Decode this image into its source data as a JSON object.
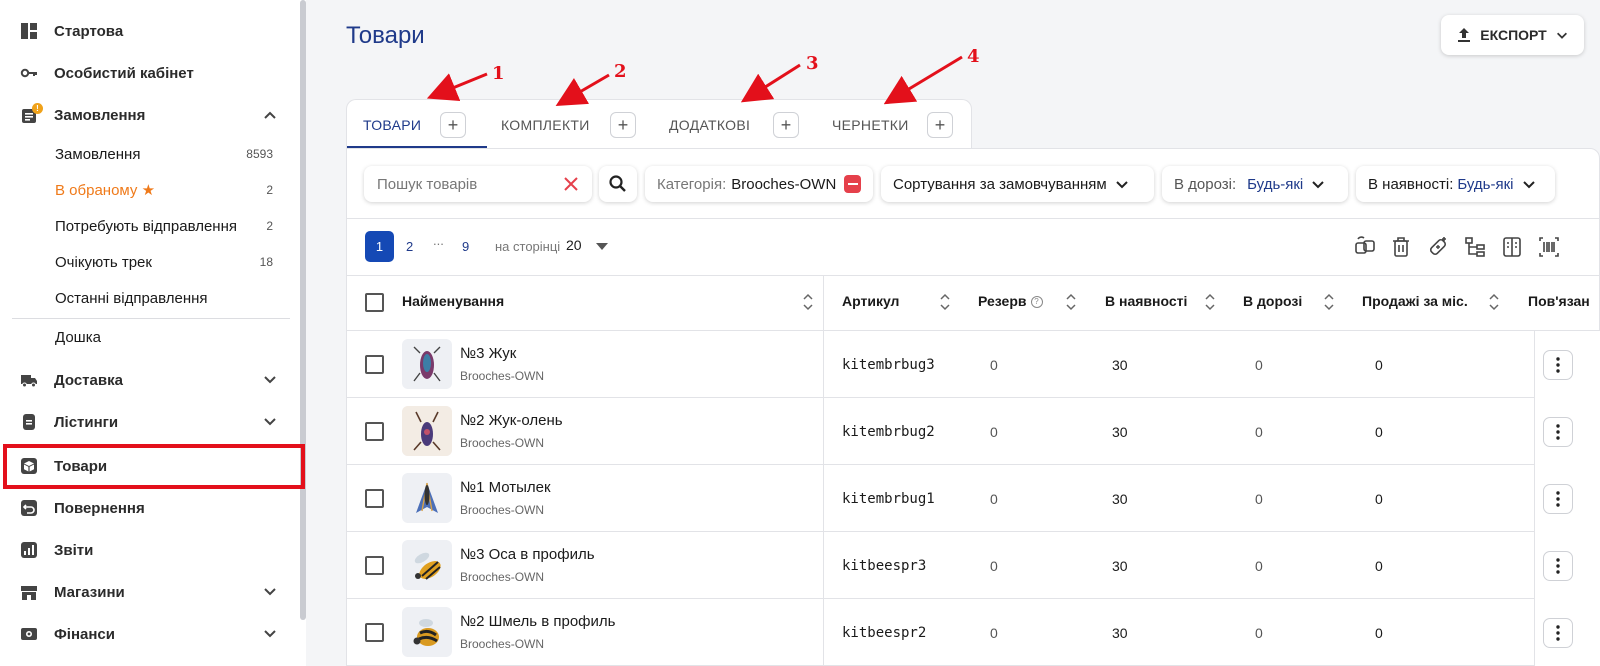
{
  "sidebar": {
    "items": [
      {
        "label": "Стартова"
      },
      {
        "label": "Особистий кабінет"
      },
      {
        "label": "Замовлення",
        "badge": "!"
      },
      {
        "label": "Дошка"
      },
      {
        "label": "Доставка"
      },
      {
        "label": "Лістинги"
      },
      {
        "label": "Товари"
      },
      {
        "label": "Повернення"
      },
      {
        "label": "Звіти"
      },
      {
        "label": "Магазини"
      },
      {
        "label": "Фінанси"
      }
    ],
    "orders_sub": [
      {
        "label": "Замовлення",
        "count": "8593"
      },
      {
        "label": "В обраному ★",
        "count": "2"
      },
      {
        "label": "Потребують відправлення",
        "count": "2"
      },
      {
        "label": "Очікують трек",
        "count": "18"
      },
      {
        "label": "Останні відправлення",
        "count": ""
      }
    ]
  },
  "header": {
    "title": "Товари",
    "export_label": "ЕКСПОРТ"
  },
  "tabs": [
    {
      "label": "ТОВАРИ"
    },
    {
      "label": "КОМПЛЕКТИ"
    },
    {
      "label": "ДОДАТКОВІ"
    },
    {
      "label": "ЧЕРНЕТКИ"
    }
  ],
  "annotations": [
    "1",
    "2",
    "3",
    "4"
  ],
  "filters": {
    "search_placeholder": "Пошук товарів",
    "category_label": "Категорія:",
    "category_value": "Brooches-OWN",
    "sort_label": "Сортування за замовчуванням",
    "in_transit_label": "В дорозі:",
    "in_transit_value": "Будь-які",
    "in_stock_label": "В наявності:",
    "in_stock_value": "Будь-які"
  },
  "pagination": {
    "current": "1",
    "page2": "2",
    "dots": "...",
    "last": "9",
    "per_page_label": "на сторінці",
    "per_page_value": "20"
  },
  "table": {
    "columns": [
      "Найменування",
      "Артикул",
      "Резерв",
      "В наявності",
      "В дорозі",
      "Продажі за міс.",
      "Пов'язан"
    ],
    "rows": [
      {
        "name": "№3 Жук",
        "category": "Brooches-OWN",
        "sku": "kitembrbug3",
        "reserve": "0",
        "in_stock": "30",
        "in_transit": "0",
        "sales": "0"
      },
      {
        "name": "№2 Жук-олень",
        "category": "Brooches-OWN",
        "sku": "kitembrbug2",
        "reserve": "0",
        "in_stock": "30",
        "in_transit": "0",
        "sales": "0"
      },
      {
        "name": "№1 Мотылек",
        "category": "Brooches-OWN",
        "sku": "kitembrbug1",
        "reserve": "0",
        "in_stock": "30",
        "in_transit": "0",
        "sales": "0"
      },
      {
        "name": "№3 Оса в профиль",
        "category": "Brooches-OWN",
        "sku": "kitbeespr3",
        "reserve": "0",
        "in_stock": "30",
        "in_transit": "0",
        "sales": "0"
      },
      {
        "name": "№2 Шмель в профиль",
        "category": "Brooches-OWN",
        "sku": "kitbeespr2",
        "reserve": "0",
        "in_stock": "30",
        "in_transit": "0",
        "sales": "0"
      }
    ]
  },
  "colors": {
    "accent": "#1f3a8a",
    "primary_button": "#1549b5",
    "favorite": "#ef7a1a",
    "annotation_red": "#e3101b"
  }
}
